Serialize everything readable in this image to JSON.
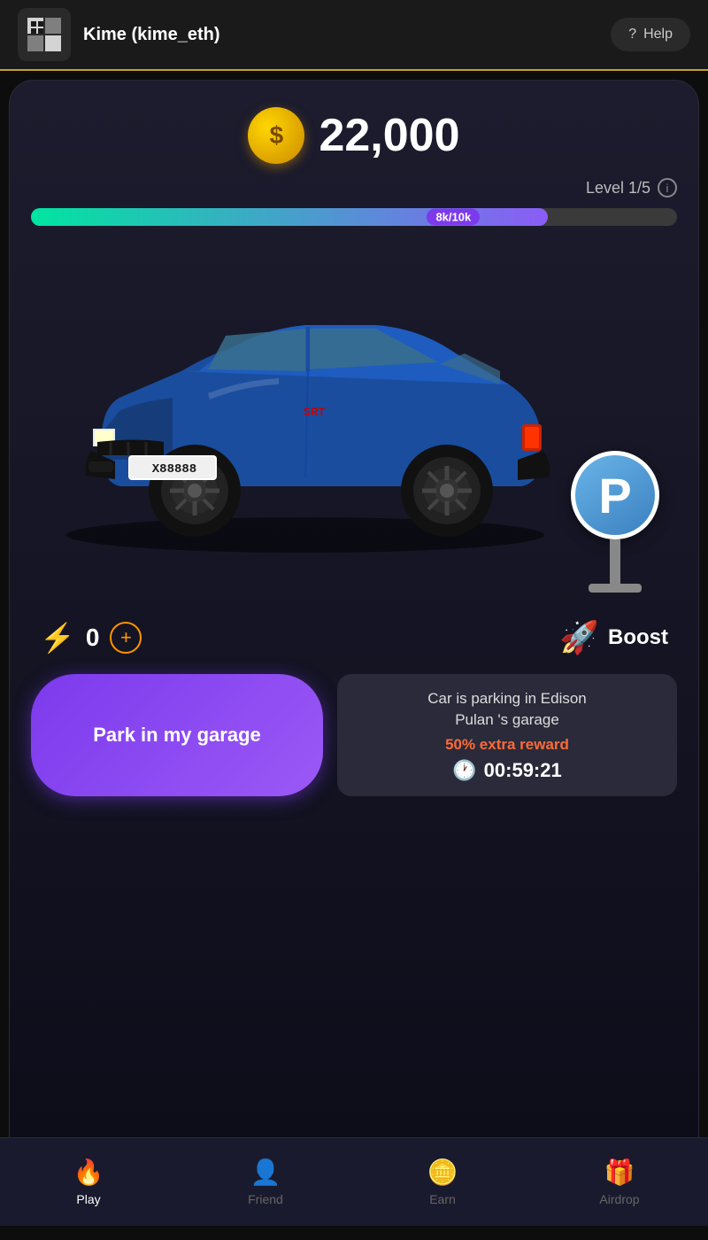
{
  "topbar": {
    "username": "Kime (kime_eth)",
    "help_label": "Help"
  },
  "currency": {
    "amount": "22,000",
    "coin_symbol": "$"
  },
  "level": {
    "text": "Level 1/5",
    "progress_current": 8000,
    "progress_max": 10000,
    "progress_label": "8k/10k",
    "progress_percent": 80
  },
  "car": {
    "license_plate": "X88888"
  },
  "energy": {
    "count": "0",
    "add_label": "+"
  },
  "boost": {
    "label": "Boost"
  },
  "actions": {
    "park_button_label": "Park in my garage",
    "parking_info_line1": "Car is parking in Edison",
    "parking_info_line2": "Pulan 's garage",
    "extra_reward": "50% extra reward",
    "timer": "00:59:21"
  },
  "bottom_nav": {
    "items": [
      {
        "label": "Play",
        "icon": "🔥",
        "active": true
      },
      {
        "label": "Friend",
        "icon": "👤",
        "active": false
      },
      {
        "label": "Earn",
        "icon": "🪙",
        "active": false
      },
      {
        "label": "Airdrop",
        "icon": "🎁",
        "active": false
      }
    ]
  }
}
